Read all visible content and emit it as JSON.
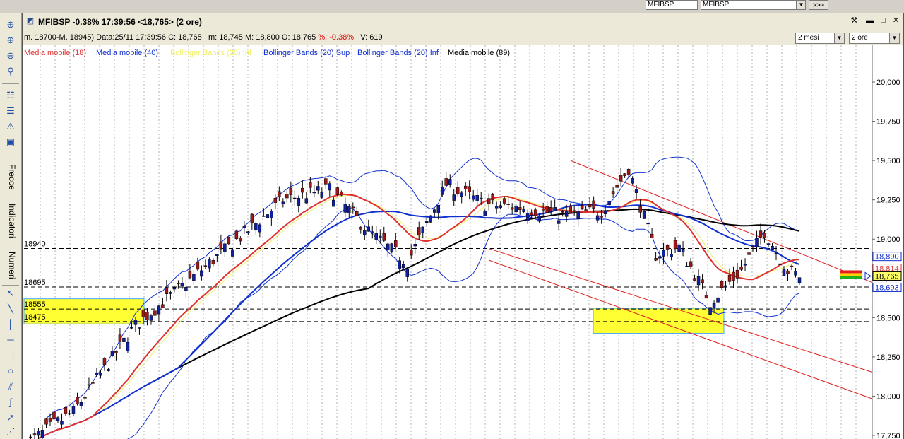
{
  "topbar": {
    "search_1": "MFIBSP",
    "search_2": "MFIBSP",
    "dropdown_icon": "chevron-down-icon",
    "go_label": ">>>"
  },
  "toolbar": {
    "label_frecce": "Frecce",
    "label_indicatori": "Indicatori",
    "label_numeri": "Numeri"
  },
  "window": {
    "title": "MFIBSP -0.38% 17:39:56  <18,765>  (2 ore)",
    "info_range": "m. 18700-M. 18945)",
    "info_date": "Data:25/11 17:39:56",
    "info_close": "C: 18,765",
    "info_min": "m: 18,745",
    "info_max": "M: 18,800",
    "info_open": "O: 18,765",
    "info_pct": "%: -0.38%",
    "info_vol": "V: 619",
    "period": "2 mesi",
    "interval": "2 ore"
  },
  "chart_data": {
    "type": "candlestick",
    "y_axis": {
      "min": 17750,
      "max": 20250,
      "ticks": [
        "20,000",
        "19,750",
        "19,500",
        "19,250",
        "19,000",
        "18,750",
        "18,500",
        "18,250",
        "18,000",
        "17,750"
      ]
    },
    "legend": [
      {
        "name": "Media mobile (18)",
        "color": "#e03030"
      },
      {
        "name": "Media mobile (40)",
        "color": "#1030d0"
      },
      {
        "name": "Bollinger Bands (20) Inf",
        "color": "#f0f060"
      },
      {
        "name": "Bollinger Bands (20) Sup",
        "color": "#1030d0"
      },
      {
        "name": "Bollinger Bands (20) Inf",
        "color": "#1030d0"
      },
      {
        "name": "Media mobile (89)",
        "color": "#000000"
      }
    ],
    "horizontal_levels": [
      {
        "label": "18940",
        "value": 18940
      },
      {
        "label": "18695",
        "value": 18695
      },
      {
        "label": "18555",
        "value": 18555
      },
      {
        "label": "18475",
        "value": 18475
      }
    ],
    "right_price_labels": [
      {
        "label": "18,890",
        "value": 18890,
        "color": "#1030d0"
      },
      {
        "label": "18,814",
        "value": 18814,
        "color": "#e03030"
      },
      {
        "label": "18,765",
        "value": 18765,
        "color": "#000000"
      },
      {
        "label": "18,693",
        "value": 18693,
        "color": "#1030d0"
      }
    ],
    "candle_count": 200,
    "close_start": 17700,
    "close_peak": 19450,
    "close_end": 18765,
    "colors": {
      "up": "#1020a0",
      "down": "#a01818",
      "ma18": "#e03030",
      "ma40": "#1030d0",
      "ma89": "#000000",
      "bollinger": "#1030d0",
      "bollinger_mid": "#f0f060",
      "channel": "#e02020",
      "highlight": "#ffff33"
    }
  }
}
